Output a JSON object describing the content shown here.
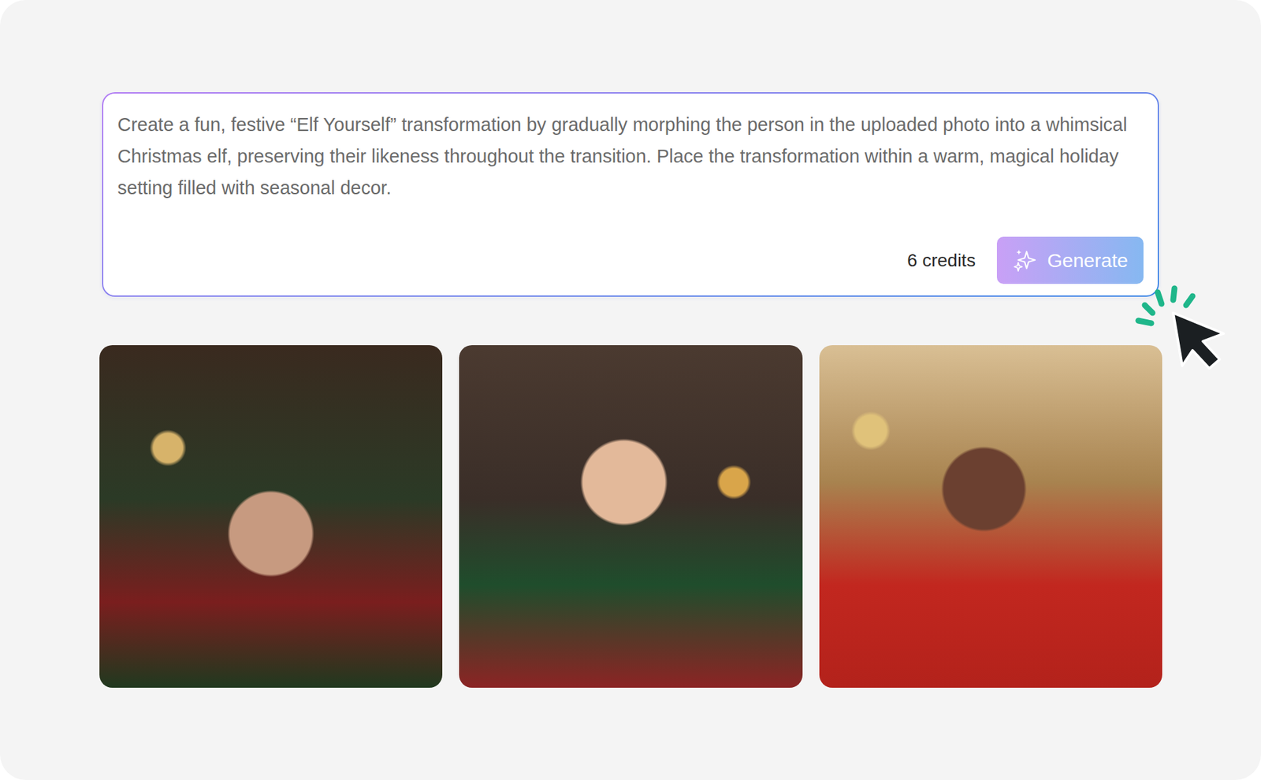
{
  "prompt": {
    "text": "Create a fun, festive “Elf Yourself” transformation by gradually morphing the person in the uploaded photo into a whimsical Christmas elf, preserving their likeness throughout the transition. Place the transformation within a warm, magical holiday setting filled with seasonal decor."
  },
  "credits": "6 credits",
  "button": "Generate"
}
